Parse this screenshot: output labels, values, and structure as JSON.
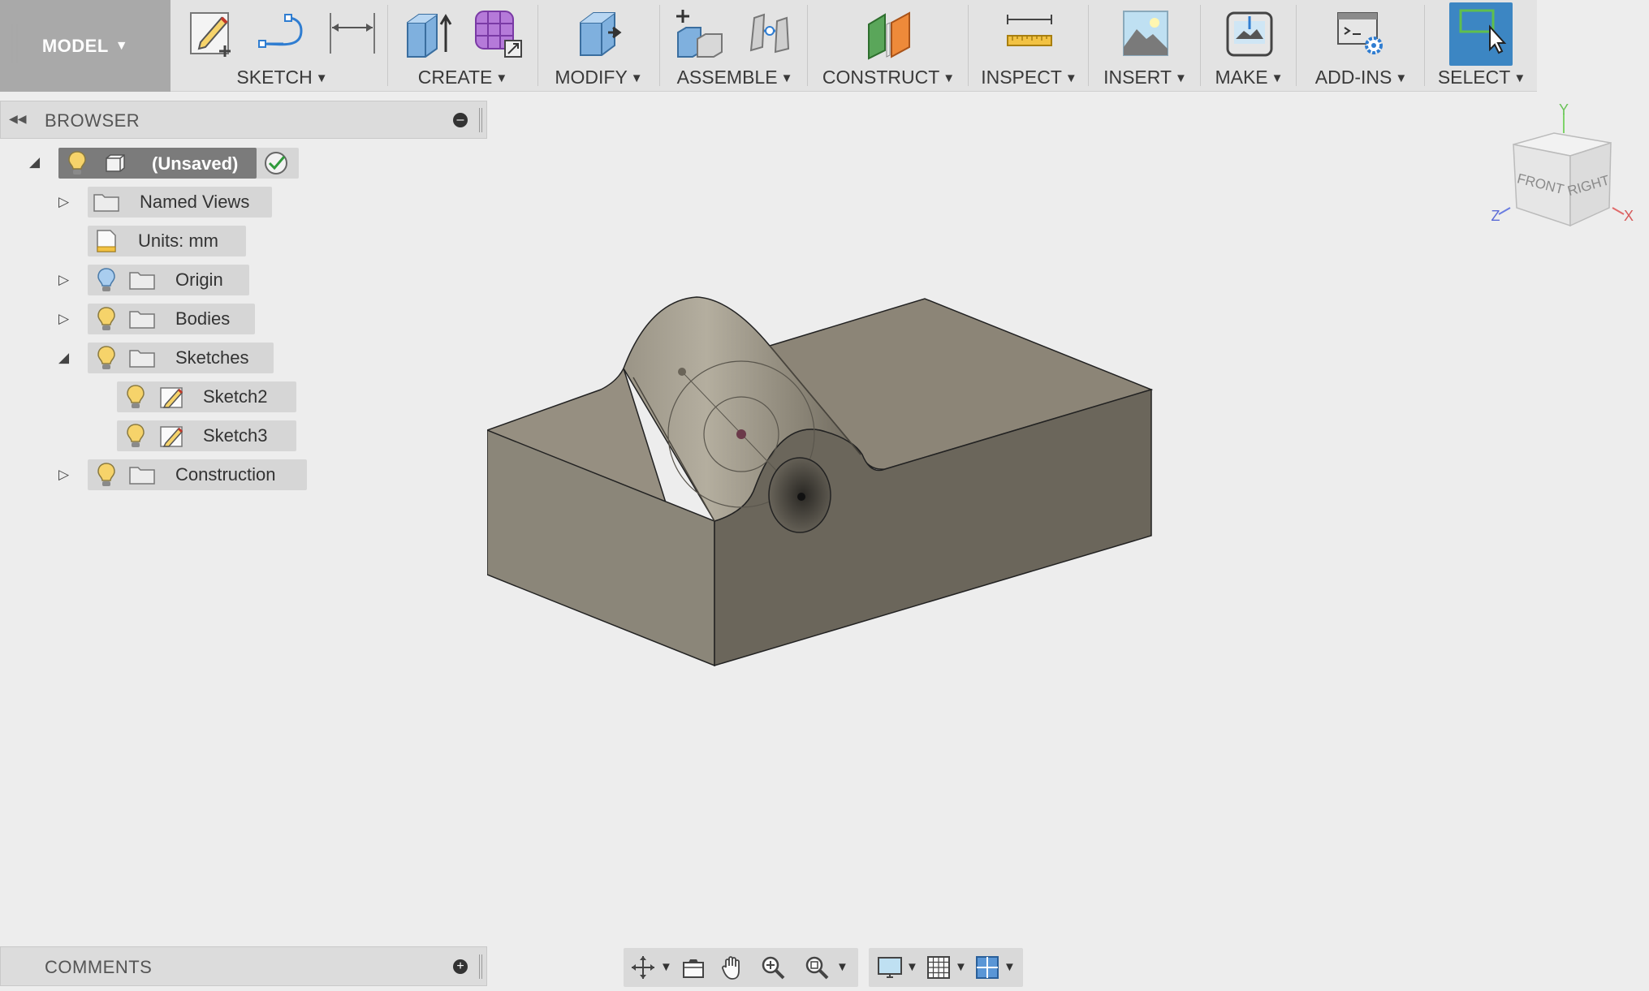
{
  "toolbar": {
    "workspace": {
      "label": "MODEL",
      "caret": "▼"
    },
    "groups": [
      {
        "label": "SKETCH",
        "caret": "▼",
        "icons": [
          "create-sketch-icon",
          "spline-icon",
          "sketch-dimension-icon"
        ]
      },
      {
        "label": "CREATE",
        "caret": "▼",
        "icons": [
          "extrude-icon",
          "create-form-icon"
        ]
      },
      {
        "label": "MODIFY",
        "caret": "▼",
        "icons": [
          "press-pull-icon"
        ]
      },
      {
        "label": "ASSEMBLE",
        "caret": "▼",
        "icons": [
          "new-component-icon",
          "joint-icon"
        ]
      },
      {
        "label": "CONSTRUCT",
        "caret": "▼",
        "icons": [
          "offset-plane-icon"
        ]
      },
      {
        "label": "INSPECT",
        "caret": "▼",
        "icons": [
          "measure-icon"
        ]
      },
      {
        "label": "INSERT",
        "caret": "▼",
        "icons": [
          "insert-image-icon"
        ]
      },
      {
        "label": "MAKE",
        "caret": "▼",
        "icons": [
          "3d-print-icon"
        ]
      },
      {
        "label": "ADD-INS",
        "caret": "▼",
        "icons": [
          "scripts-addins-icon"
        ]
      },
      {
        "label": "SELECT",
        "caret": "▼",
        "icons": [
          "window-select-icon"
        ]
      }
    ]
  },
  "browser": {
    "title": "BROWSER",
    "root": {
      "label": "(Unsaved)"
    },
    "items": [
      {
        "label": "Named Views"
      },
      {
        "label": "Units: mm"
      },
      {
        "label": "Origin"
      },
      {
        "label": "Bodies"
      },
      {
        "label": "Sketches"
      },
      {
        "label": "Sketch2"
      },
      {
        "label": "Sketch3"
      },
      {
        "label": "Construction"
      }
    ]
  },
  "comments": {
    "title": "COMMENTS"
  },
  "viewcube": {
    "front": "FRONT",
    "right": "RIGHT",
    "axis_x": "X",
    "axis_y": "Y",
    "axis_z": "Z"
  },
  "colors": {
    "select_accent": "#3c86c3",
    "toolbar_bg": "#e3e3e3",
    "canvas_bg": "#ededed",
    "model_face": "#8a8478"
  }
}
